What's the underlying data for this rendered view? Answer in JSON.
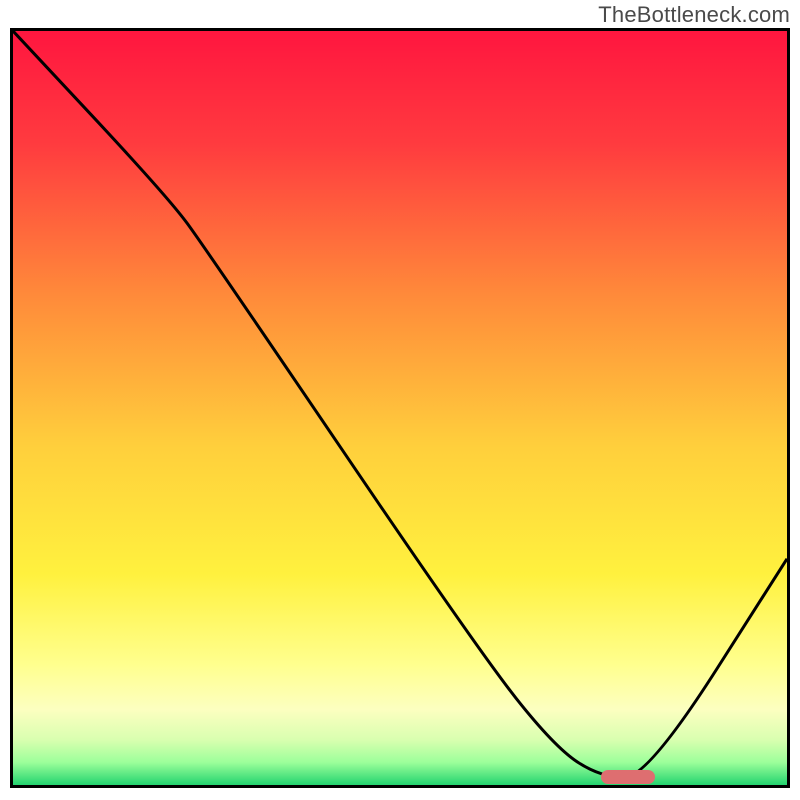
{
  "watermark": "TheBottleneck.com",
  "chart_data": {
    "type": "line",
    "title": "",
    "xlabel": "",
    "ylabel": "",
    "xlim": [
      0,
      100
    ],
    "ylim": [
      0,
      100
    ],
    "background_gradient": {
      "orientation": "vertical",
      "stops": [
        {
          "pos": 0.0,
          "color": "#ff163f"
        },
        {
          "pos": 0.15,
          "color": "#ff3b3f"
        },
        {
          "pos": 0.35,
          "color": "#ff8a3a"
        },
        {
          "pos": 0.55,
          "color": "#ffcf3c"
        },
        {
          "pos": 0.72,
          "color": "#fff13e"
        },
        {
          "pos": 0.84,
          "color": "#ffff8e"
        },
        {
          "pos": 0.9,
          "color": "#fcffc0"
        },
        {
          "pos": 0.94,
          "color": "#d9ffb0"
        },
        {
          "pos": 0.97,
          "color": "#9cff9a"
        },
        {
          "pos": 1.0,
          "color": "#23d36f"
        }
      ]
    },
    "series": [
      {
        "name": "bottleneck-curve",
        "color": "#000000",
        "points": [
          {
            "x": 0,
            "y": 100
          },
          {
            "x": 20,
            "y": 78
          },
          {
            "x": 25,
            "y": 71
          },
          {
            "x": 60,
            "y": 18
          },
          {
            "x": 70,
            "y": 5
          },
          {
            "x": 76,
            "y": 1
          },
          {
            "x": 82,
            "y": 1
          },
          {
            "x": 100,
            "y": 30
          }
        ]
      }
    ],
    "marker": {
      "name": "sweet-spot",
      "x_start": 76,
      "x_end": 83,
      "y": 1,
      "color": "#de6e70"
    }
  }
}
